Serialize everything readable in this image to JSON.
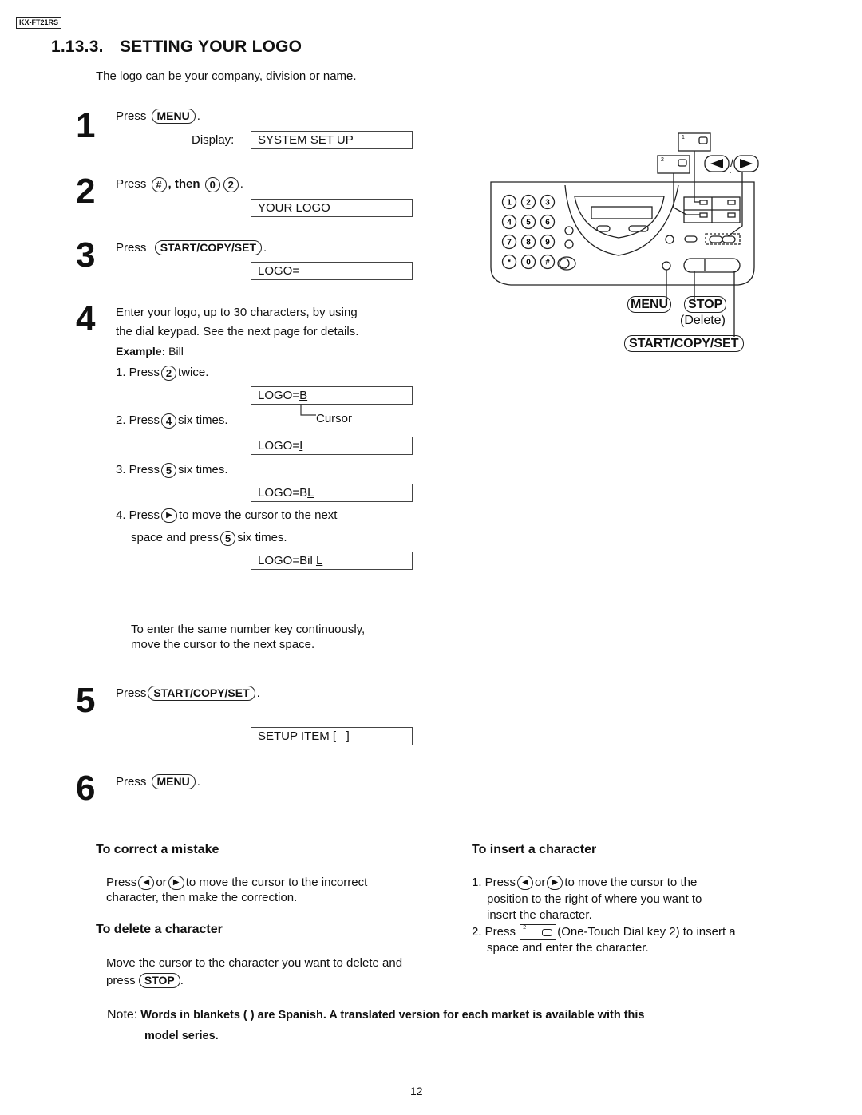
{
  "header": {
    "model": "KX-FT21RS"
  },
  "section": {
    "number": "1.13.3.",
    "title": "SETTING YOUR LOGO",
    "intro": "The logo can be your company, division or name."
  },
  "steps": {
    "s1": {
      "num": "1",
      "press": "Press",
      "key": "MENU",
      "display_label": "Display:",
      "display": "SYSTEM SET UP"
    },
    "s2": {
      "num": "2",
      "press": "Press",
      "key_hash": "#",
      "then": ", then",
      "key_0": "0",
      "key_2": "2",
      "display": "YOUR LOGO"
    },
    "s3": {
      "num": "3",
      "press": "Press",
      "key": "START/COPY/SET",
      "display": "LOGO="
    },
    "s4": {
      "num": "4",
      "line1": "Enter your logo, up to 30 characters, by using",
      "line2": "the dial keypad. See the next page for details.",
      "example_label": "Example:",
      "example_value": "Bill",
      "sub1": {
        "pre": "1. Press",
        "key": "2",
        "post": "twice.",
        "display_prefix": "LOGO=",
        "display_cursor": "B"
      },
      "cursor_label": "Cursor",
      "sub2": {
        "pre": "2. Press",
        "key": "4",
        "post": "six times.",
        "display_prefix": "LOGO=",
        "display_cursor": "I"
      },
      "sub3": {
        "pre": "3. Press",
        "key": "5",
        "post": "six times.",
        "display_prefix": "LOGO=B",
        "display_cursor": "L"
      },
      "sub4": {
        "pre": "4. Press",
        "post": "to move the cursor to the next",
        "line2_pre": "space and press",
        "key": "5",
        "line2_post": "six times.",
        "display_prefix": "LOGO=Bil ",
        "display_cursor": "L"
      },
      "tip_line1": "To enter the same number key continuously,",
      "tip_line2": "move the cursor to the next space."
    },
    "s5": {
      "num": "5",
      "press": "Press",
      "key": "START/COPY/SET",
      "display": "SETUP ITEM [   ]"
    },
    "s6": {
      "num": "6",
      "press": "Press",
      "key": "MENU"
    }
  },
  "diagram": {
    "keypad": [
      "1",
      "2",
      "3",
      "4",
      "5",
      "6",
      "7",
      "8",
      "9",
      "*",
      "0",
      "#"
    ],
    "onetouch1": "1",
    "onetouch2": "2",
    "label_menu": "MENU",
    "label_stop": "STOP",
    "label_delete": "(Delete)",
    "label_start": "START/COPY/SET",
    "slash": "/"
  },
  "correct": {
    "heading": "To correct a mistake",
    "press": "Press",
    "or": "or",
    "line1": "to move the cursor to the incorrect",
    "line2": "character, then make the correction."
  },
  "delete": {
    "heading": "To delete a character",
    "line1": "Move the cursor to the character you want to delete and",
    "press": "press",
    "key": "STOP"
  },
  "insert": {
    "heading": "To insert a character",
    "i1_pre": "1. Press",
    "or": "or",
    "i1_post": "to move the cursor to the",
    "i1_line2": "position to the right of where you want to",
    "i1_line3": "insert the character.",
    "i2_pre": "2. Press",
    "otkey_num": "2",
    "i2_post": "(One-Touch Dial key 2) to insert a",
    "i2_line2": "space and enter the character."
  },
  "note": {
    "label": "Note:",
    "text": "Words in blankets ( ) are Spanish. A translated version for each market is available with this",
    "text2": "model series."
  },
  "footer": {
    "page": "12"
  }
}
